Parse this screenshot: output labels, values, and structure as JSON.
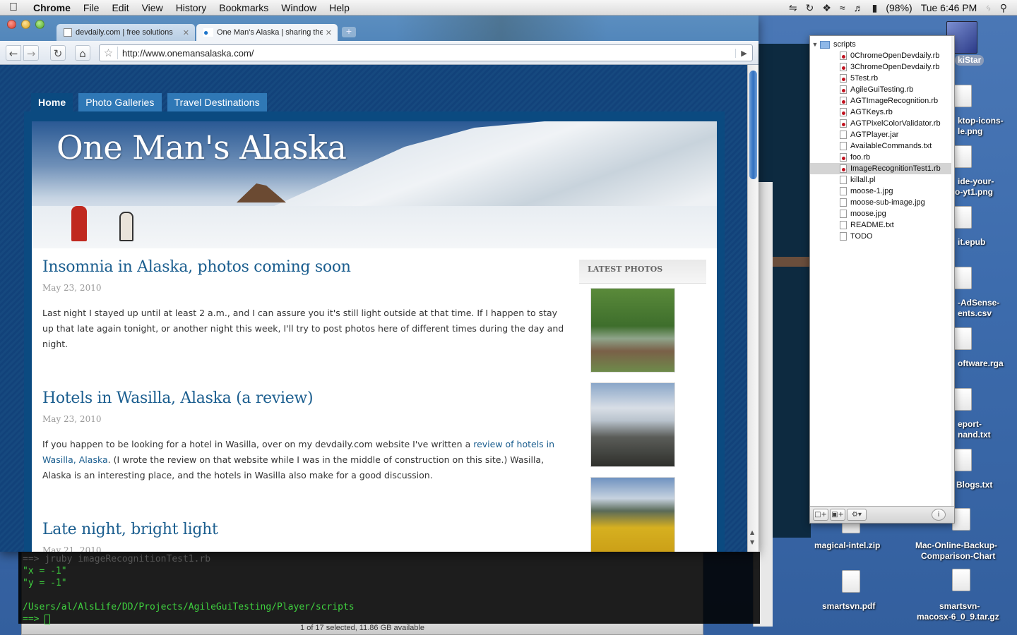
{
  "menubar": {
    "app_name": "Chrome",
    "items": [
      "File",
      "Edit",
      "View",
      "History",
      "Bookmarks",
      "Window",
      "Help"
    ],
    "battery": "(98%)",
    "clock": "Tue 6:46 PM"
  },
  "browser": {
    "tabs": [
      {
        "title": "devdaily.com | free solutions"
      },
      {
        "title": "One Man's Alaska | sharing the"
      }
    ],
    "url": "http://www.onemansalaska.com/"
  },
  "site": {
    "nav": [
      {
        "label": "Home",
        "active": true
      },
      {
        "label": "Photo Galleries",
        "active": false
      },
      {
        "label": "Travel Destinations",
        "active": false
      }
    ],
    "title": "One Man's Alaska",
    "posts": [
      {
        "title": "Insomnia in Alaska, photos coming soon",
        "date": "May 23, 2010",
        "body": "Last night I stayed up until at least 2 a.m., and I can assure you it's still light outside at that time. If I happen to stay up that late again tonight, or another night this week, I'll try to post photos here of different times during the day and night."
      },
      {
        "title": "Hotels in Wasilla, Alaska (a review)",
        "date": "May 23, 2010",
        "body_before": "If you happen to be looking for a hotel in Wasilla, over on my devdaily.com website I've written a ",
        "link": "review of hotels in Wasilla, Alaska",
        "body_after": ". (I wrote the review on that website while I was in the middle of construction on this site.) Wasilla, Alaska is an interesting place, and the hotels in Wasilla also make for a good discussion."
      },
      {
        "title": "Late night, bright light",
        "date": "May 21, 2010"
      }
    ],
    "sidebar_heading": "LATEST PHOTOS"
  },
  "terminal": {
    "lines": [
      "==> jruby imageRecognitionTest1.rb",
      "\"x = -1\"",
      "\"y = -1\"",
      "/Users/al/AlsLife/DD/Projects/AgileGuiTesting/Player/scripts",
      "==> "
    ]
  },
  "finder_status": "1 of 17 selected, 11.86 GB available",
  "file_list": {
    "folder": "scripts",
    "files": [
      {
        "name": "0ChromeOpenDevdaily.rb",
        "type": "rb"
      },
      {
        "name": "3ChromeOpenDevdaily.rb",
        "type": "rb"
      },
      {
        "name": "5Test.rb",
        "type": "rb"
      },
      {
        "name": "AgileGuiTesting.rb",
        "type": "rb"
      },
      {
        "name": "AGTImageRecognition.rb",
        "type": "rb"
      },
      {
        "name": "AGTKeys.rb",
        "type": "rb"
      },
      {
        "name": "AGTPixelColorValidator.rb",
        "type": "rb"
      },
      {
        "name": "AGTPlayer.jar",
        "type": "jar"
      },
      {
        "name": "AvailableCommands.txt",
        "type": "txt"
      },
      {
        "name": "foo.rb",
        "type": "rb"
      },
      {
        "name": "ImageRecognitionTest1.rb",
        "type": "rb",
        "selected": true
      },
      {
        "name": "killall.pl",
        "type": "txt"
      },
      {
        "name": "moose-1.jpg",
        "type": "txt"
      },
      {
        "name": "moose-sub-image.jpg",
        "type": "txt"
      },
      {
        "name": "moose.jpg",
        "type": "txt"
      },
      {
        "name": "README.txt",
        "type": "txt"
      },
      {
        "name": "TODO",
        "type": "txt"
      }
    ]
  },
  "desktop_icons": {
    "kistar": "kiStar",
    "desktop_icons_png": [
      "ktop-icons-",
      "le.png"
    ],
    "hide_your": [
      "ide-your-",
      "o-yt1.png"
    ],
    "epub": "it.epub",
    "adsense": [
      "-AdSense-",
      "ents.csv"
    ],
    "software": "oftware.rga",
    "report": [
      "eport-",
      "nand.txt"
    ],
    "blogs": "Blogs.txt",
    "magical": "magical-intel.zip",
    "mac_backup": [
      "Mac-Online-Backup-",
      "Comparison-Chart"
    ],
    "smartsvn_pdf": "smartsvn.pdf",
    "smartsvn_tgz": [
      "smartsvn-",
      "macosx-6_0_9.tar.gz"
    ]
  },
  "colors": {
    "site_blue": "#0b4a80",
    "link_blue": "#1b5e8f",
    "terminal_green": "#3fd13f"
  }
}
